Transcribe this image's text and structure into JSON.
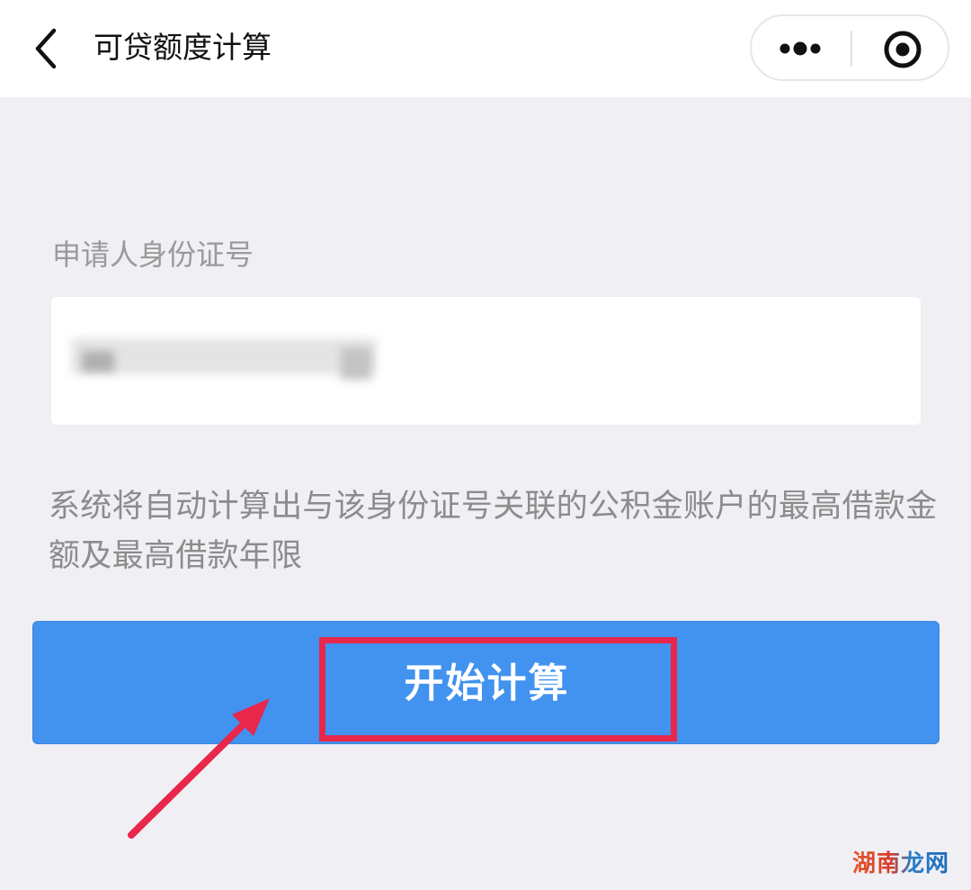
{
  "navbar": {
    "title": "可贷额度计算",
    "icons": {
      "back": "chevron-left-icon",
      "more": "more-dots-icon",
      "close": "record-close-icon"
    }
  },
  "form": {
    "id_label": "申请人身份证号",
    "id_value_obscured": true
  },
  "hint": "系统将自动计算出与该身份证号关联的公积金账户的最高借款金额及最高借款年限",
  "start_button": {
    "label": "开始计算"
  },
  "colors": {
    "button": "#4292ef",
    "highlight": "#e8274b",
    "background": "#efeff4"
  },
  "watermark": {
    "text": "湖南龙网"
  }
}
